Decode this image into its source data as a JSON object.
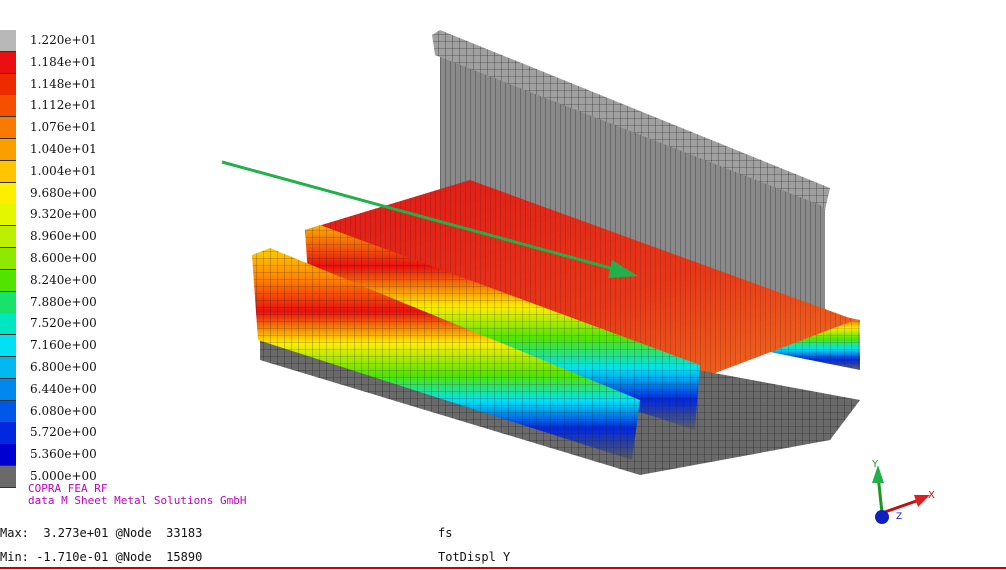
{
  "legend": {
    "colors": [
      "#b8b8b8",
      "#e81010",
      "#ee2a00",
      "#f45000",
      "#f87a00",
      "#fb9e00",
      "#ffc600",
      "#ffee00",
      "#e4f600",
      "#bdf000",
      "#8ee800",
      "#52e400",
      "#18e26a",
      "#00e6c0",
      "#00e2f4",
      "#00b8f0",
      "#0088ee",
      "#0058ea",
      "#0028e0",
      "#0000d0",
      "#6a6a6a"
    ],
    "labels": [
      "1.220e+01",
      "1.184e+01",
      "1.148e+01",
      "1.112e+01",
      "1.076e+01",
      "1.040e+01",
      "1.004e+01",
      "9.680e+00",
      "9.320e+00",
      "8.960e+00",
      "8.600e+00",
      "8.240e+00",
      "7.880e+00",
      "7.520e+00",
      "7.160e+00",
      "6.800e+00",
      "6.440e+00",
      "6.080e+00",
      "5.720e+00",
      "5.360e+00",
      "5.000e+00"
    ]
  },
  "credit": {
    "line1": "COPRA FEA RF",
    "line2": "data M Sheet Metal Solutions GmbH"
  },
  "status": {
    "max": "Max:  3.273e+01 @Node  33183",
    "min": "Min: -1.710e-01 @Node  15890",
    "step": "fs",
    "result": "TotDispl Y"
  },
  "triad": {
    "x_label": "X",
    "y_label": "Y",
    "z_label": "Z"
  },
  "arrow_color": "#22b04a"
}
